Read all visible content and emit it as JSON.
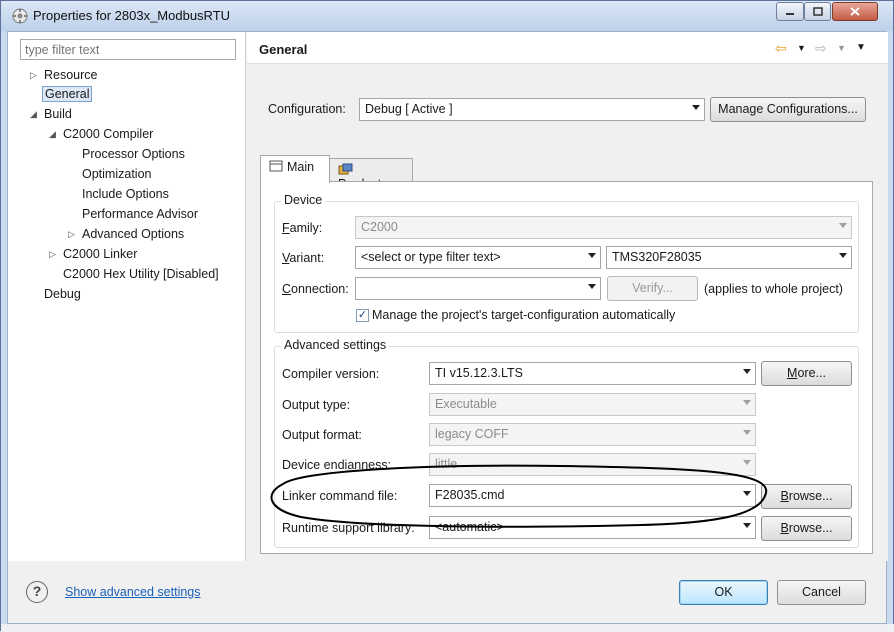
{
  "window": {
    "title": "Properties for 2803x_ModbusRTU"
  },
  "filter": {
    "placeholder": "type filter text"
  },
  "tree": {
    "resource": "Resource",
    "general": "General",
    "build": "Build",
    "c2000_compiler": "C2000 Compiler",
    "processor_options": "Processor Options",
    "optimization": "Optimization",
    "include_options": "Include Options",
    "performance_advisor": "Performance Advisor",
    "advanced_options": "Advanced Options",
    "c2000_linker": "C2000 Linker",
    "c2000_hex_utility": "C2000 Hex Utility  [Disabled]",
    "debug": "Debug"
  },
  "page": {
    "title": "General"
  },
  "configuration": {
    "label": "Configuration:",
    "value": "Debug  [ Active ]",
    "manage_button": "Manage Configurations..."
  },
  "tabs": {
    "main": "Main",
    "products": "Products"
  },
  "device": {
    "group_title": "Device",
    "family_label": "Family:",
    "family_value": "C2000",
    "variant_label": "Variant:",
    "variant_filter": "<select or type filter text>",
    "variant_value": "TMS320F28035",
    "connection_label": "Connection:",
    "connection_value": "",
    "verify_button": "Verify...",
    "applies_note": "(applies to whole project)",
    "manage_checkbox_label": "Manage the project's target-configuration automatically",
    "manage_checked": true
  },
  "advanced": {
    "group_title": "Advanced settings",
    "compiler_label": "Compiler version:",
    "compiler_value": "TI v15.12.3.LTS",
    "more_button": "More...",
    "output_type_label": "Output type:",
    "output_type_value": "Executable",
    "output_format_label": "Output format:",
    "output_format_value": "legacy COFF",
    "endianness_label": "Device endianness:",
    "endianness_value": "little",
    "linker_label": "Linker command file:",
    "linker_value": "F28035.cmd",
    "browse_button_1": "Browse...",
    "runtime_label": "Runtime support library:",
    "runtime_value": "<automatic>",
    "browse_button_2": "Browse..."
  },
  "footer": {
    "help": "?",
    "show_advanced": "Show advanced settings",
    "ok": "OK",
    "cancel": "Cancel"
  },
  "colors": {
    "link": "#1c5fb8",
    "selection": "#dde8f6",
    "annotation": "#000000"
  }
}
